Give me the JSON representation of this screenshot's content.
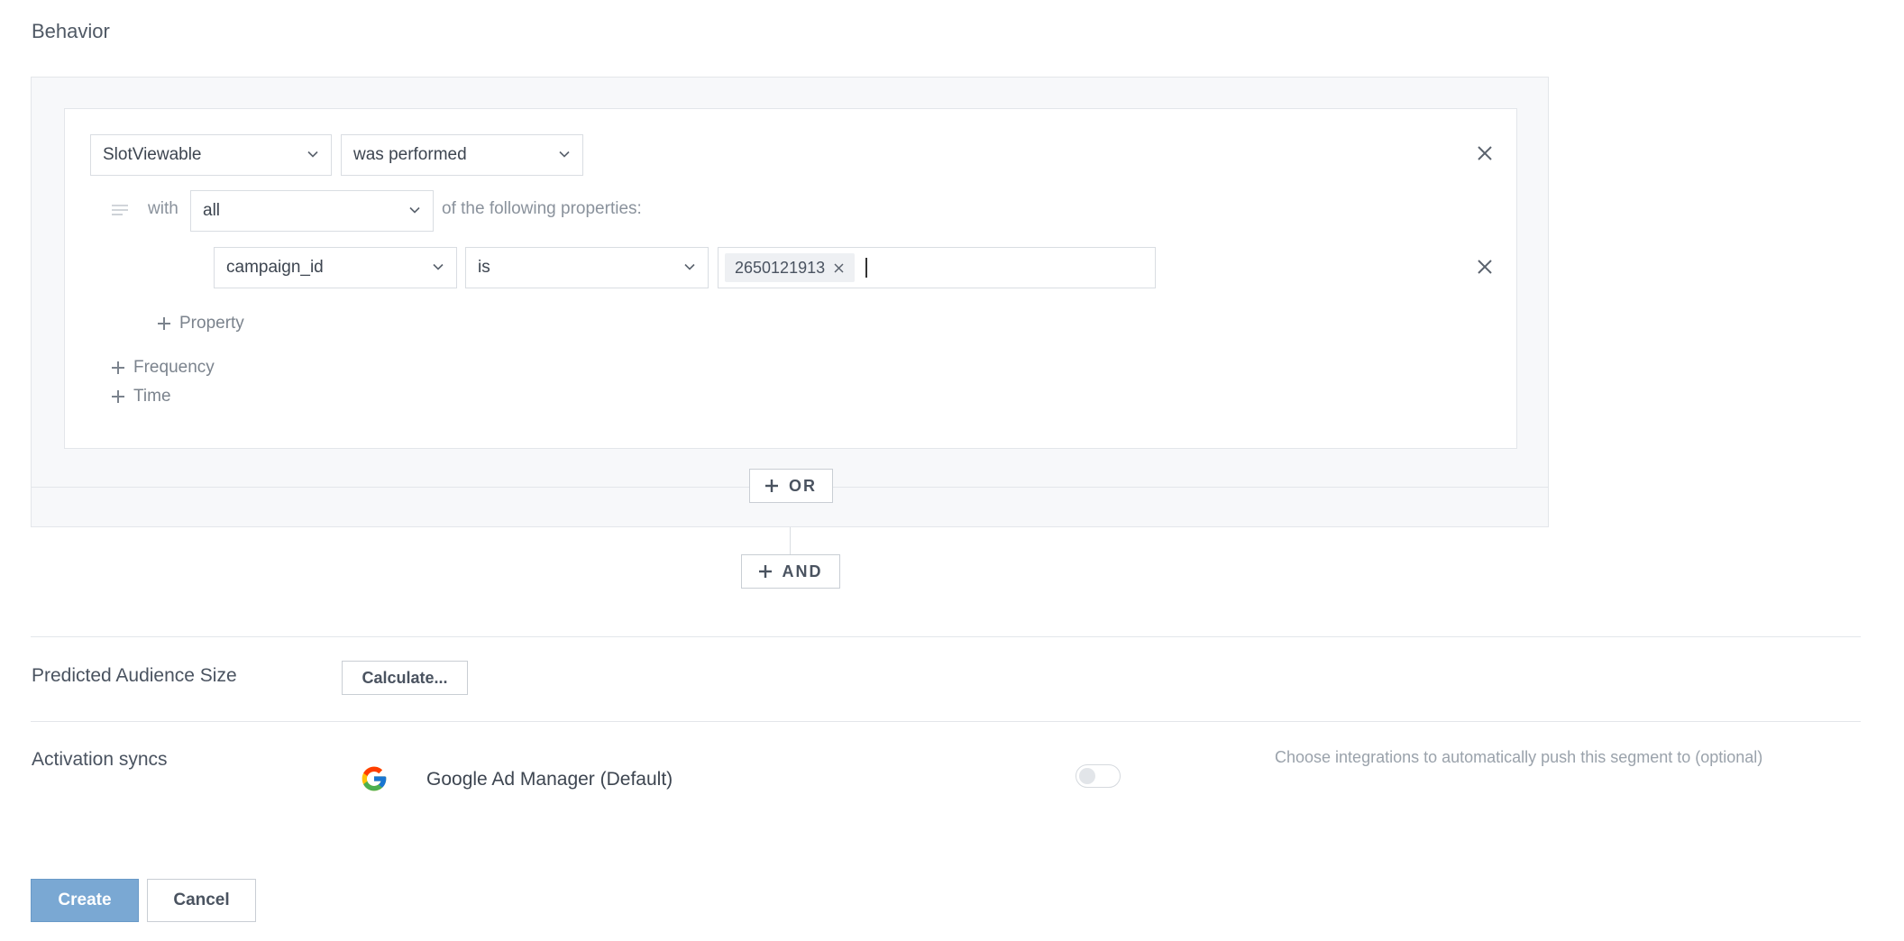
{
  "behavior": {
    "title": "Behavior",
    "condition": {
      "event_select": "SlotViewable",
      "performed_select": "was performed",
      "with_label": "with",
      "match_select": "all",
      "properties_label": "of the following properties:",
      "property": {
        "name_select": "campaign_id",
        "operator_select": "is",
        "values": [
          "2650121913"
        ]
      },
      "add_property_label": "Property",
      "add_frequency_label": "Frequency",
      "add_time_label": "Time"
    },
    "or_button_label": "OR",
    "and_button_label": "AND"
  },
  "audience": {
    "label": "Predicted Audience Size",
    "calculate_label": "Calculate..."
  },
  "activation": {
    "label": "Activation syncs",
    "integration_name": "Google Ad Manager (Default)",
    "integration_icon": "google-logo-icon",
    "enabled": false,
    "hint": "Choose integrations to automatically push this segment to (optional)"
  },
  "actions": {
    "create_label": "Create",
    "cancel_label": "Cancel",
    "create_color": "#7aa8d3"
  }
}
